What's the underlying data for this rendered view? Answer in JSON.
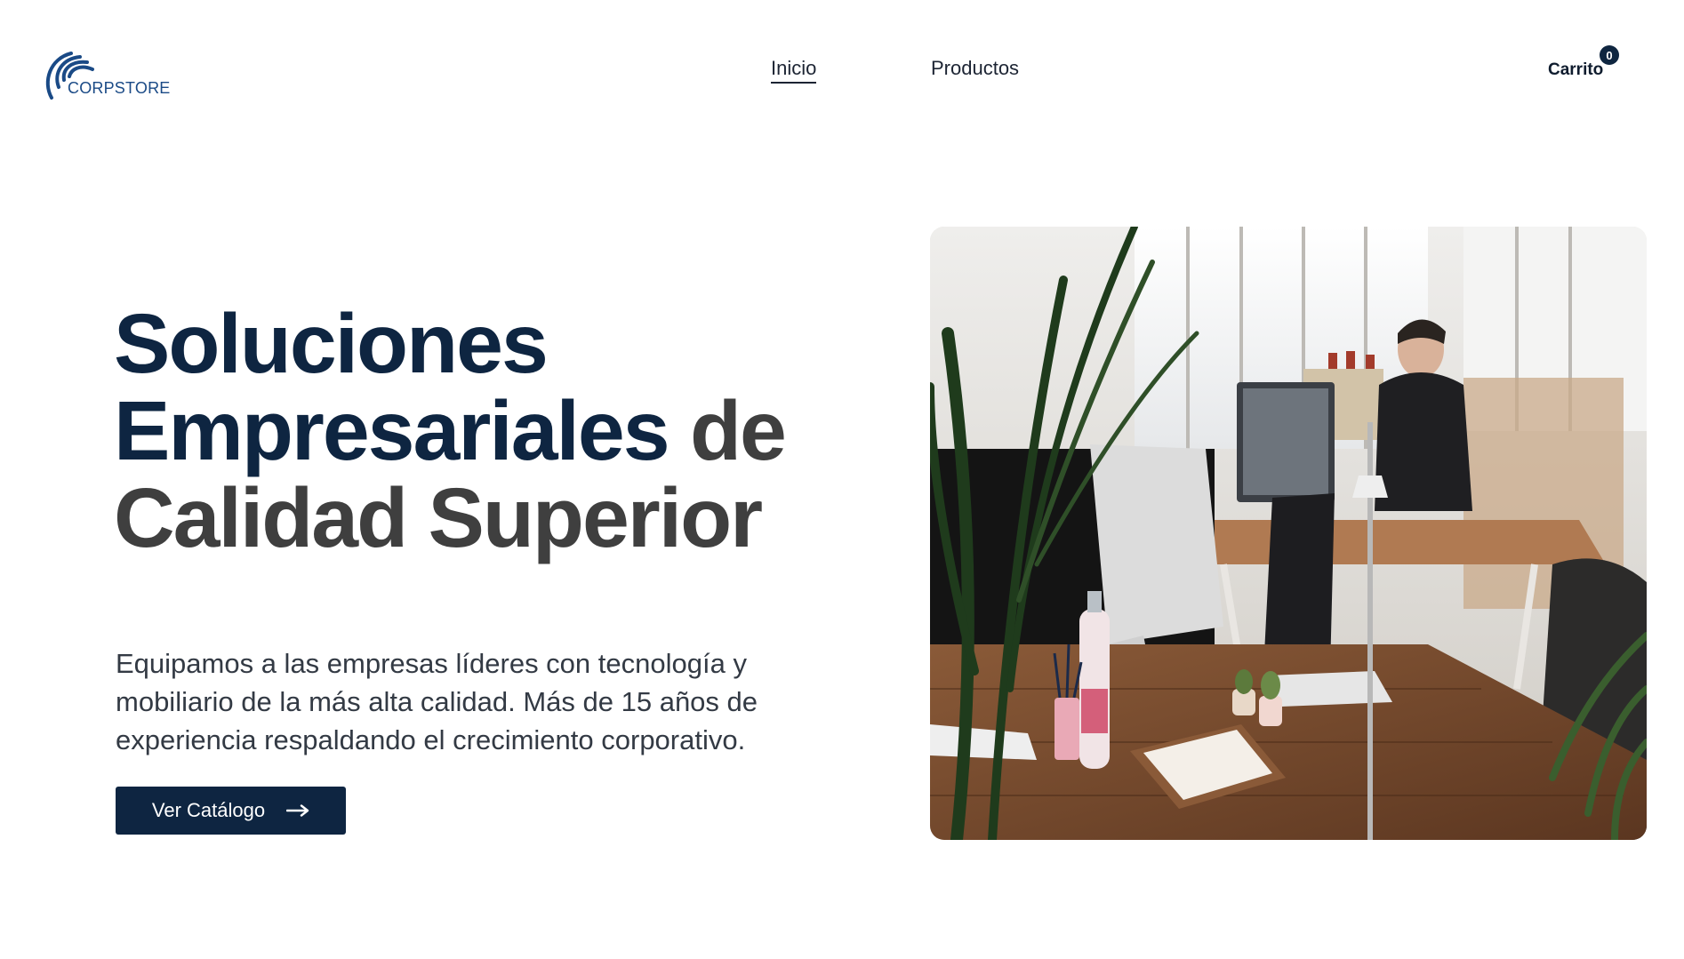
{
  "brand": {
    "name": "CORPSTORE",
    "color": "#1a4a86"
  },
  "nav": {
    "items": [
      {
        "label": "Inicio",
        "active": true
      },
      {
        "label": "Productos",
        "active": false
      }
    ]
  },
  "cart": {
    "label": "Carrito",
    "count": "0"
  },
  "hero": {
    "title_line1": "Soluciones",
    "title_line2_dark": "Empresariales",
    "title_line2_grey": "de",
    "title_line3": "Calidad Superior",
    "description": "Equipamos a las empresas líderes con tecnología y mobiliario de la más alta calidad. Más de 15 años de experiencia respaldando el crecimiento corporativo.",
    "cta_label": "Ver Catálogo",
    "cta_icon": "arrow-right-icon",
    "image": "office-workspace-photo"
  },
  "colors": {
    "primary": "#0e2541",
    "title_grey": "#3f3f3f",
    "text": "#333a44",
    "background": "#ffffff"
  }
}
